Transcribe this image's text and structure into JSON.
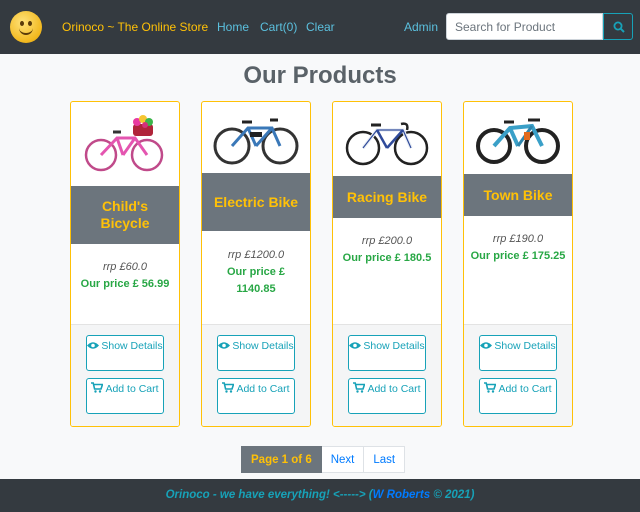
{
  "navbar": {
    "brand": "Orinoco ~ The Online Store",
    "home": "Home",
    "cart": "Cart(0)",
    "clear": "Clear",
    "admin": "Admin",
    "search_placeholder": "Search for Product",
    "logo_icon": "smiley-logo-icon",
    "search_icon": "search-icon"
  },
  "page_title": "Our Products",
  "products": [
    {
      "name": "Child's Bicycle",
      "rrp": "rrp £60.0",
      "price": "Our price £ 56.99",
      "image_icon": "pink-bicycle-with-flower-basket"
    },
    {
      "name": "Electric Bike",
      "rrp": "rrp £1200.0",
      "price": "Our price £ 1140.85",
      "image_icon": "blue-electric-bike"
    },
    {
      "name": "Racing Bike",
      "rrp": "rrp £200.0",
      "price": "Our price £ 180.5",
      "image_icon": "white-racing-bike"
    },
    {
      "name": "Town Bike",
      "rrp": "rrp £190.0",
      "price": "Our price £ 175.25",
      "image_icon": "blue-mountain-bike"
    }
  ],
  "buttons": {
    "show_details": "Show Details",
    "add_to_cart": "Add to Cart",
    "eye_icon": "eye-icon",
    "cart_icon": "cart-icon"
  },
  "pagination": {
    "current": "Page 1 of 6",
    "next": "Next",
    "last": "Last"
  },
  "footer": {
    "tagline": "Orinoco - we have everything! <-----> (",
    "author": "W Roberts",
    "year": " © 2021)"
  },
  "colors": {
    "navbar": "#343a40",
    "accent": "#ffc107",
    "link": "#5bc0de",
    "price": "#28a745",
    "band": "#6c757d",
    "button": "#17a2b8"
  }
}
